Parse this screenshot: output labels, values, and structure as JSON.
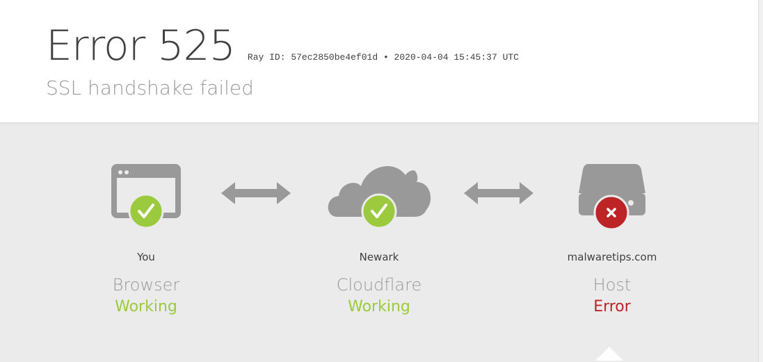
{
  "header": {
    "title": "Error 525",
    "ray": "Ray ID: 57ec2850be4ef01d • 2020-04-04 15:45:37 UTC",
    "subtitle": "SSL handshake failed"
  },
  "nodes": [
    {
      "location": "You",
      "name": "Browser",
      "status": "Working",
      "status_color": "#9bca3e",
      "icon": "browser-icon",
      "badge": "check-icon"
    },
    {
      "location": "Newark",
      "name": "Cloudflare",
      "status": "Working",
      "status_color": "#9bca3e",
      "icon": "cloud-icon",
      "badge": "check-icon"
    },
    {
      "location": "malwaretips.com",
      "name": "Host",
      "status": "Error",
      "status_color": "#bd2426",
      "icon": "server-icon",
      "badge": "cross-icon"
    }
  ],
  "colors": {
    "icon_gray": "#999999",
    "ok_green": "#9bca3e",
    "error_red": "#bd2426",
    "panel_bg": "#ebebeb"
  }
}
